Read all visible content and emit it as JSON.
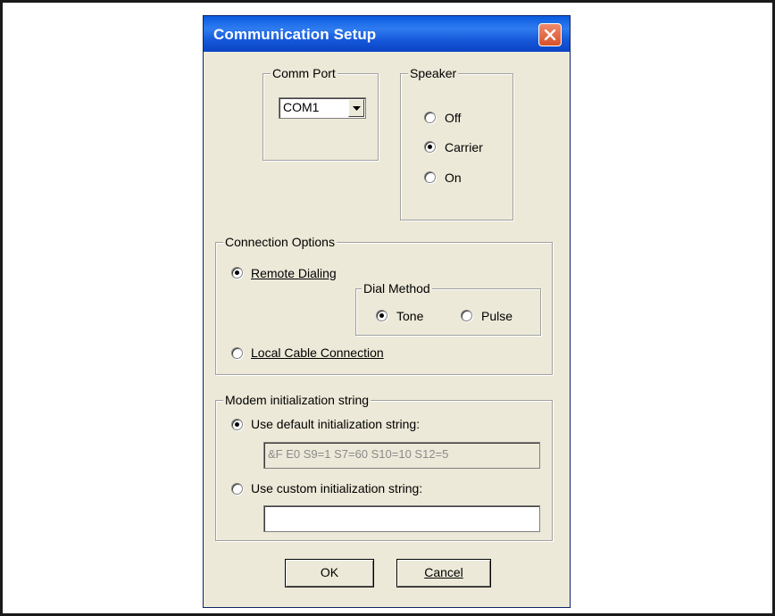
{
  "dialog": {
    "title": "Communication Setup",
    "close_icon": "close-icon"
  },
  "comm_port": {
    "legend": "Comm Port",
    "selected": "COM1",
    "dropdown_icon": "chevron-down-icon"
  },
  "speaker": {
    "legend": "Speaker",
    "options": [
      {
        "label": "Off",
        "checked": false
      },
      {
        "label": "Carrier",
        "checked": true
      },
      {
        "label": "On",
        "checked": false
      }
    ]
  },
  "connection": {
    "legend": "Connection Options",
    "remote_label": "Remote Dialing",
    "remote_checked": true,
    "dial_method": {
      "legend": "Dial Method",
      "tone_label": "Tone",
      "tone_checked": true,
      "pulse_label": "Pulse",
      "pulse_checked": false
    },
    "local_label": "Local Cable Connection",
    "local_checked": false
  },
  "modem": {
    "legend": "Modem initialization string",
    "default_label": "Use default initialization string:",
    "default_checked": true,
    "default_value": "&F E0 S9=1 S7=60 S10=10 S12=5",
    "custom_label": "Use custom initialization string:",
    "custom_checked": false,
    "custom_value": ""
  },
  "buttons": {
    "ok": "OK",
    "cancel": "Cancel"
  },
  "colors": {
    "title_bar": "#0a5adf",
    "dialog_bg": "#ece9d8",
    "close_button": "#d8522a"
  }
}
